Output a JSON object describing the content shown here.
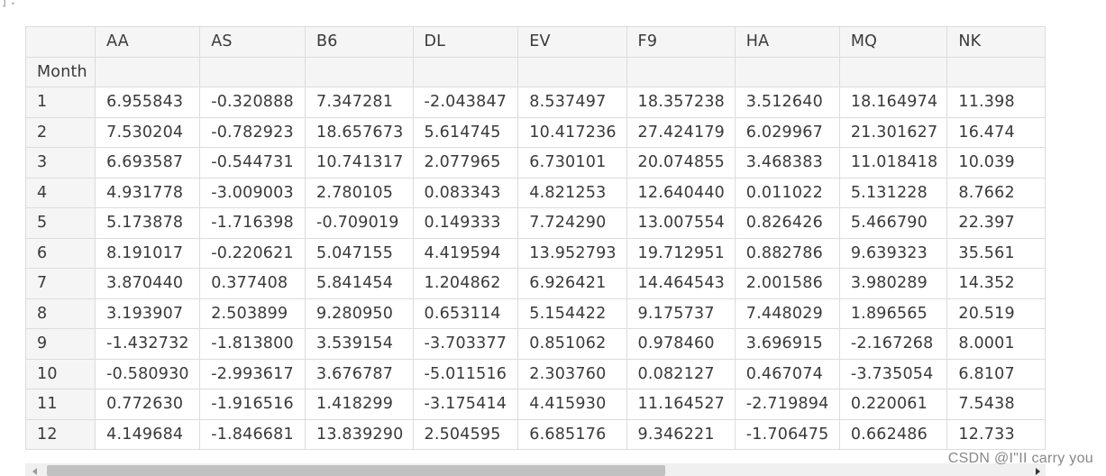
{
  "fragment_text": "]:",
  "table": {
    "index_name": "Month",
    "columns": [
      "AA",
      "AS",
      "B6",
      "DL",
      "EV",
      "F9",
      "HA",
      "MQ",
      "NK"
    ],
    "rows": [
      {
        "index": "1",
        "values": [
          "6.955843",
          "-0.320888",
          "7.347281",
          "-2.043847",
          "8.537497",
          "18.357238",
          "3.512640",
          "18.164974",
          "11.398"
        ]
      },
      {
        "index": "2",
        "values": [
          "7.530204",
          "-0.782923",
          "18.657673",
          "5.614745",
          "10.417236",
          "27.424179",
          "6.029967",
          "21.301627",
          "16.474"
        ]
      },
      {
        "index": "3",
        "values": [
          "6.693587",
          "-0.544731",
          "10.741317",
          "2.077965",
          "6.730101",
          "20.074855",
          "3.468383",
          "11.018418",
          "10.039"
        ]
      },
      {
        "index": "4",
        "values": [
          "4.931778",
          "-3.009003",
          "2.780105",
          "0.083343",
          "4.821253",
          "12.640440",
          "0.011022",
          "5.131228",
          "8.7662"
        ]
      },
      {
        "index": "5",
        "values": [
          "5.173878",
          "-1.716398",
          "-0.709019",
          "0.149333",
          "7.724290",
          "13.007554",
          "0.826426",
          "5.466790",
          "22.397"
        ]
      },
      {
        "index": "6",
        "values": [
          "8.191017",
          "-0.220621",
          "5.047155",
          "4.419594",
          "13.952793",
          "19.712951",
          "0.882786",
          "9.639323",
          "35.561"
        ]
      },
      {
        "index": "7",
        "values": [
          "3.870440",
          "0.377408",
          "5.841454",
          "1.204862",
          "6.926421",
          "14.464543",
          "2.001586",
          "3.980289",
          "14.352"
        ]
      },
      {
        "index": "8",
        "values": [
          "3.193907",
          "2.503899",
          "9.280950",
          "0.653114",
          "5.154422",
          "9.175737",
          "7.448029",
          "1.896565",
          "20.519"
        ]
      },
      {
        "index": "9",
        "values": [
          "-1.432732",
          "-1.813800",
          "3.539154",
          "-3.703377",
          "0.851062",
          "0.978460",
          "3.696915",
          "-2.167268",
          "8.0001"
        ]
      },
      {
        "index": "10",
        "values": [
          "-0.580930",
          "-2.993617",
          "3.676787",
          "-5.011516",
          "2.303760",
          "0.082127",
          "0.467074",
          "-3.735054",
          "6.8107"
        ]
      },
      {
        "index": "11",
        "values": [
          "0.772630",
          "-1.916516",
          "1.418299",
          "-3.175414",
          "4.415930",
          "11.164527",
          "-2.719894",
          "0.220061",
          "7.5438"
        ]
      },
      {
        "index": "12",
        "values": [
          "4.149684",
          "-1.846681",
          "13.839290",
          "2.504595",
          "6.685176",
          "9.346221",
          "-1.706475",
          "0.662486",
          "12.733"
        ]
      }
    ]
  },
  "watermark": "CSDN @I\"II  carry  you"
}
